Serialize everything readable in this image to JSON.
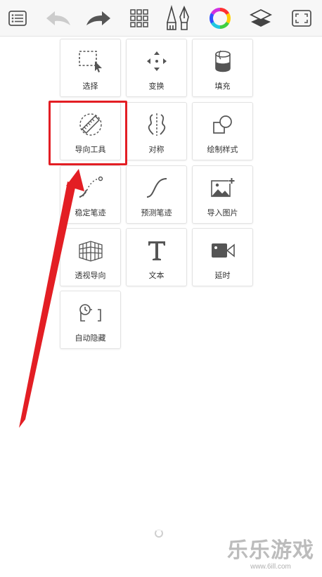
{
  "toolbar": {
    "icons": [
      "list-icon",
      "undo-icon",
      "redo-icon",
      "grid-icon",
      "brush-pen-icon",
      "color-wheel-icon",
      "layers-icon",
      "fullscreen-icon"
    ]
  },
  "tools": [
    {
      "label": "选择",
      "icon": "selection-icon"
    },
    {
      "label": "变换",
      "icon": "transform-icon"
    },
    {
      "label": "填充",
      "icon": "fill-bucket-icon"
    },
    {
      "label": "导向工具",
      "icon": "ruler-guide-icon"
    },
    {
      "label": "对称",
      "icon": "symmetry-icon"
    },
    {
      "label": "绘制样式",
      "icon": "draw-style-icon"
    },
    {
      "label": "稳定笔迹",
      "icon": "stabilizer-icon"
    },
    {
      "label": "预测笔迹",
      "icon": "predictive-stroke-icon"
    },
    {
      "label": "导入图片",
      "icon": "import-image-icon"
    },
    {
      "label": "透视导向",
      "icon": "perspective-grid-icon"
    },
    {
      "label": "文本",
      "icon": "text-icon"
    },
    {
      "label": "延时",
      "icon": "timelapse-icon"
    },
    {
      "label": "自动隐藏",
      "icon": "auto-hide-icon"
    }
  ],
  "annotation": {
    "color": "#e31e24"
  },
  "watermark": {
    "main": "乐乐游戏",
    "url": "www.6ill.com"
  }
}
